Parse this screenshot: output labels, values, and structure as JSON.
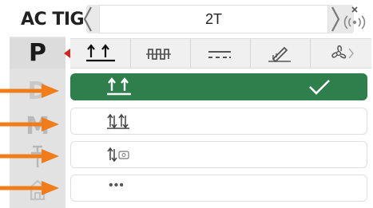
{
  "header": {
    "mode_title": "AC TIG",
    "job_value": "2T"
  },
  "rail": {
    "items": [
      {
        "label": "P",
        "active": true
      },
      {
        "label": "D",
        "active": false
      },
      {
        "label": "M",
        "active": false
      }
    ]
  },
  "tabs": [
    "trigger-2t-icon",
    "pulse-icon",
    "dc-line-icon",
    "torch-pen-icon",
    "fan-icon"
  ],
  "options": {
    "items": [
      {
        "icon": "trigger-2t-icon",
        "selected": true
      },
      {
        "icon": "trigger-4t-icon",
        "selected": false
      },
      {
        "icon": "trigger-remote-icon",
        "selected": false
      },
      {
        "label": "•••",
        "selected": false
      }
    ],
    "check_icon": "check-icon"
  },
  "colors": {
    "selected_bg": "#2e7f4c",
    "arrow": "#f07d1a",
    "marker": "#d0281e",
    "rail_bg": "#e2e2e2"
  }
}
